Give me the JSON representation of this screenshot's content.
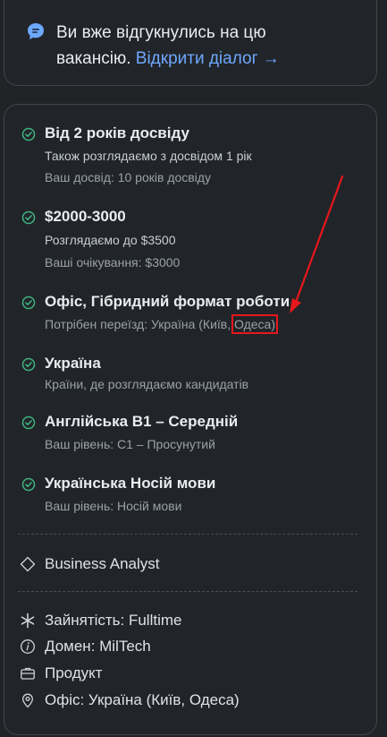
{
  "applied": {
    "text": "Ви вже відгукнулись на цю вакансію.",
    "link": "Відкрити діалог →"
  },
  "requirements": [
    {
      "title": "Від 2 років досвіду",
      "sub1": "Також розглядаємо з досвідом 1 рік",
      "sub2": "Ваш досвід: 10 років досвіду"
    },
    {
      "title": "$2000-3000",
      "sub1": "Розглядаємо до $3500",
      "sub2": "Ваші очікування: $3000"
    },
    {
      "title": "Офіс, Гібридний формат роботи",
      "sub1_prefix": "Потрібен переїзд: Україна (Київ,",
      "sub1_highlight": "Одеса)"
    },
    {
      "title": "Україна",
      "sub1": "Країни, де розглядаємо кандидатів"
    },
    {
      "title": "Англійська B1 – Середній",
      "sub1": "Ваш рівень: C1 – Просунутий"
    },
    {
      "title": "Українська Носій мови",
      "sub1": "Ваш рівень: Носій мови"
    }
  ],
  "role": {
    "label": "Business Analyst",
    "icon": "diamond-icon"
  },
  "details": [
    {
      "label": "Зайнятість: Fulltime",
      "icon": "asterisk-icon"
    },
    {
      "label": "Домен: MilTech",
      "icon": "info-icon"
    },
    {
      "label": "Продукт",
      "icon": "briefcase-icon"
    },
    {
      "label": "Офіс: Україна (Київ, Одеса)",
      "icon": "location-pin-icon"
    }
  ],
  "colors": {
    "accent_link": "#6ea8fe",
    "check": "#3fb37f",
    "annotation": "#e8171c"
  }
}
